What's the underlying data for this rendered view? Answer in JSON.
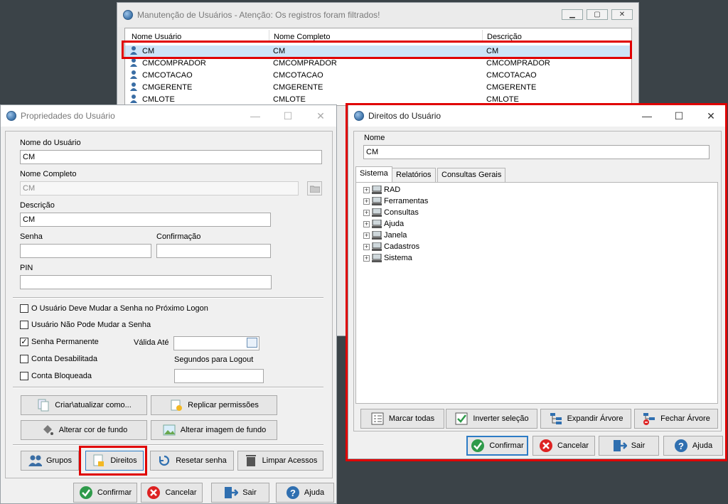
{
  "bg_window": {
    "title": "Manutenção de Usuários - Atenção: Os registros foram filtrados!",
    "columns": [
      "Nome Usuário",
      "Nome Completo",
      "Descrição"
    ],
    "rows": [
      [
        "CM",
        "CM",
        "CM"
      ],
      [
        "CMCOMPRADOR",
        "CMCOMPRADOR",
        "CMCOMPRADOR"
      ],
      [
        "CMCOTACAO",
        "CMCOTACAO",
        "CMCOTACAO"
      ],
      [
        "CMGERENTE",
        "CMGERENTE",
        "CMGERENTE"
      ],
      [
        "CMLOTE",
        "CMLOTE",
        "CMLOTE"
      ]
    ]
  },
  "props": {
    "title": "Propriedades do Usuário",
    "nome_usuario_label": "Nome do Usuário",
    "nome_usuario_value": "CM",
    "nome_completo_label": "Nome Completo",
    "nome_completo_value": "CM",
    "descricao_label": "Descrição",
    "descricao_value": "CM",
    "senha_label": "Senha",
    "confirmacao_label": "Confirmação",
    "pin_label": "PIN",
    "chk_mudar_senha": "O Usuário Deve Mudar a Senha no Próximo Logon",
    "chk_nao_pode": "Usuário Não Pode Mudar a Senha",
    "chk_permanente": "Senha Permanente",
    "valida_ate_label": "Válida Até",
    "chk_desabilitada": "Conta Desabilitada",
    "logout_label": "Segundos para Logout",
    "chk_bloqueada": "Conta Bloqueada",
    "btn_criar": "Criar\\atualizar como...",
    "btn_replicar": "Replicar permissões",
    "btn_cor": "Alterar cor de fundo",
    "btn_imagem": "Alterar imagem de fundo",
    "btn_grupos": "Grupos",
    "btn_direitos": "Direitos",
    "btn_resetar": "Resetar senha",
    "btn_limpar": "Limpar Acessos",
    "btn_confirmar": "Confirmar",
    "btn_cancelar": "Cancelar",
    "btn_sair": "Sair",
    "btn_ajuda": "Ajuda"
  },
  "rights": {
    "title": "Direitos do Usuário",
    "nome_label": "Nome",
    "nome_value": "CM",
    "tabs": [
      "Sistema",
      "Relatórios",
      "Consultas Gerais"
    ],
    "tree": [
      "RAD",
      "Ferramentas",
      "Consultas",
      "Ajuda",
      "Janela",
      "Cadastros",
      "Sistema"
    ],
    "btn_marcar": "Marcar todas",
    "btn_inverter": "Inverter seleção",
    "btn_expandir": "Expandir Árvore",
    "btn_fechar": "Fechar Árvore",
    "btn_confirmar": "Confirmar",
    "btn_cancelar": "Cancelar",
    "btn_sair": "Sair",
    "btn_ajuda": "Ajuda"
  },
  "colors": {
    "highlight": "#e00000",
    "selection": "#cde4f7",
    "accent": "#2f6fb0"
  }
}
